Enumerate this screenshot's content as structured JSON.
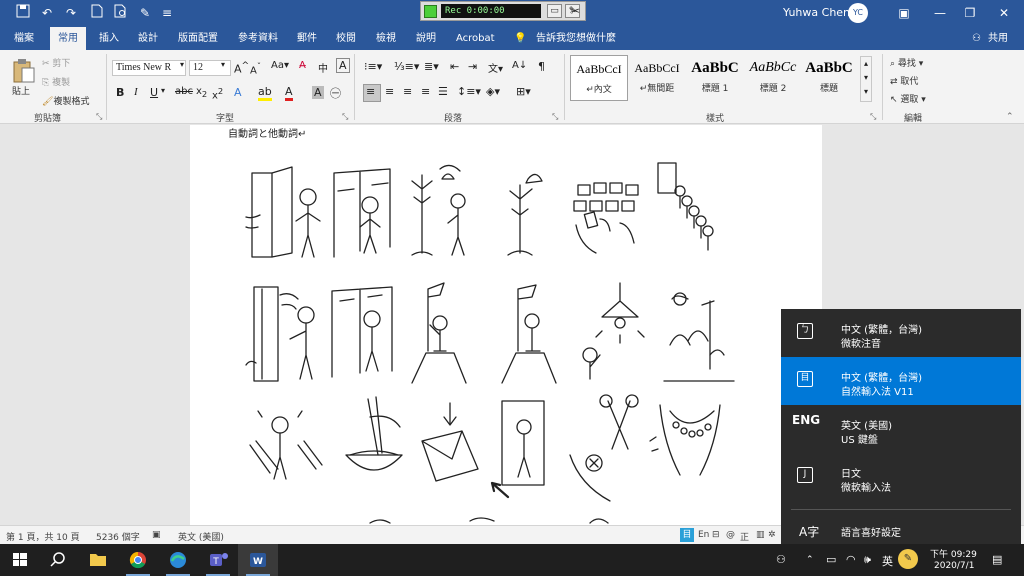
{
  "titlebar": {
    "recorder_time": "Rec 0:00:00",
    "user_name": "Yuhwa Chen",
    "user_initials": "YC"
  },
  "tabs": [
    "檔案",
    "常用",
    "插入",
    "設計",
    "版面配置",
    "參考資料",
    "郵件",
    "校閱",
    "檢視",
    "說明",
    "Acrobat",
    "告訴我您想做什麼"
  ],
  "share_label": "共用",
  "ribbon": {
    "clipboard": {
      "paste": "貼上",
      "cut": "剪下",
      "copy": "複製",
      "format_painter": "複製格式",
      "label": "剪貼簿"
    },
    "font": {
      "name": "Times New R",
      "size": "12",
      "label": "字型"
    },
    "paragraph": {
      "label": "段落"
    },
    "styles": {
      "items": [
        {
          "sample": "AaBbCcI",
          "name": "內文"
        },
        {
          "sample": "AaBbCcI",
          "name": "無間距"
        },
        {
          "sample": "AaBbC",
          "name": "標題 1"
        },
        {
          "sample": "AaBbCc",
          "name": "標題 2"
        },
        {
          "sample": "AaBbC",
          "name": "標題"
        }
      ],
      "label": "樣式"
    },
    "editing": {
      "find": "尋找",
      "replace": "取代",
      "select": "選取",
      "label": "編輯"
    }
  },
  "document": {
    "heading": "自動詞と他動詞↵"
  },
  "statusbar": {
    "page": "第 1 頁，共 10 頁",
    "words": "5236 個字",
    "language": "英文 (美國)"
  },
  "language_panel": {
    "items": [
      {
        "line1": "中文 (繁體，台灣)",
        "line2": "微軟注音",
        "icon": "zhuyin-icon"
      },
      {
        "line1": "中文 (繁體，台灣)",
        "line2": "自然輸入法 V11",
        "icon": "natural-ime-icon"
      },
      {
        "line1": "英文 (美國)",
        "line2": "US 鍵盤",
        "icon_text": "ENG"
      },
      {
        "line1": "日文",
        "line2": "微軟輸入法",
        "icon": "japanese-ime-icon"
      }
    ],
    "preferences": "語言喜好設定"
  },
  "taskbar": {
    "ime_indicator": "英",
    "time": "下午 09:29",
    "date": "2020/7/1"
  },
  "colors": {
    "word_blue": "#2b579a",
    "taskbar": "#1f1f1f",
    "selected_blue": "#0078d7"
  }
}
